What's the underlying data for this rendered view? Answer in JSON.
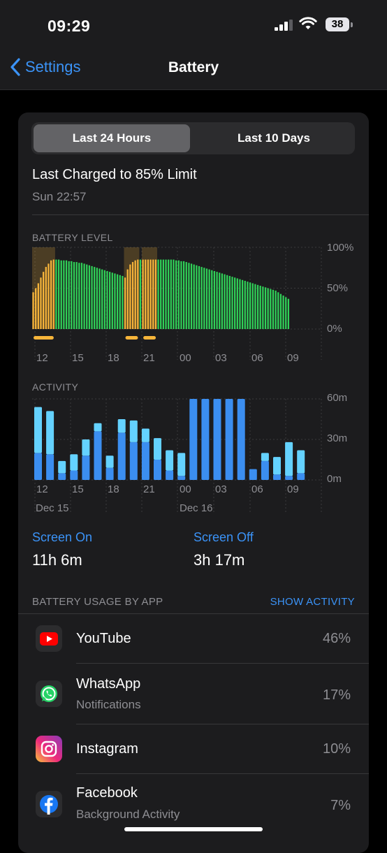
{
  "status_bar": {
    "time": "09:29",
    "battery_percent": "38"
  },
  "nav": {
    "back_label": "Settings",
    "title": "Battery"
  },
  "segmented": {
    "options": [
      "Last 24 Hours",
      "Last 10 Days"
    ],
    "selected": "Last 24 Hours"
  },
  "last_charged": {
    "title": "Last Charged to 85% Limit",
    "time": "Sun 22:57"
  },
  "battery_level": {
    "label": "BATTERY LEVEL",
    "y_ticks": [
      "100%",
      "50%",
      "0%"
    ],
    "x_ticks": [
      "12",
      "15",
      "18",
      "21",
      "00",
      "03",
      "06",
      "09"
    ]
  },
  "activity": {
    "label": "ACTIVITY",
    "y_ticks": [
      "60m",
      "30m",
      "0m"
    ],
    "x_ticks": [
      "12",
      "15",
      "18",
      "21",
      "00",
      "03",
      "06",
      "09"
    ],
    "dates": [
      "Dec 15",
      "Dec 16"
    ]
  },
  "screen": {
    "on_label": "Screen On",
    "on_value": "11h 6m",
    "off_label": "Screen Off",
    "off_value": "3h 17m"
  },
  "usage": {
    "header": "BATTERY USAGE BY APP",
    "show_activity": "SHOW ACTIVITY",
    "apps": [
      {
        "name": "YouTube",
        "subtitle": "",
        "percent": "46%",
        "icon": "youtube-icon"
      },
      {
        "name": "WhatsApp",
        "subtitle": "Notifications",
        "percent": "17%",
        "icon": "whatsapp-icon"
      },
      {
        "name": "Instagram",
        "subtitle": "",
        "percent": "10%",
        "icon": "instagram-icon"
      },
      {
        "name": "Facebook",
        "subtitle": "Background Activity",
        "percent": "7%",
        "icon": "facebook-icon"
      }
    ]
  },
  "colors": {
    "accent": "#3b93f7",
    "battery_green": "#30d158",
    "battery_charging": "#f7b53a",
    "activity_light": "#64d2ff",
    "activity_dark": "#3b8ef0",
    "card": "#1c1c1e"
  },
  "chart_data": [
    {
      "type": "bar",
      "title": "BATTERY LEVEL",
      "ylim": [
        0,
        100
      ],
      "y_unit": "%",
      "x_start_hour": 11.5,
      "hours_per_bar": 0.25,
      "levels": [
        45,
        50,
        56,
        63,
        70,
        76,
        80,
        84,
        85,
        85,
        85,
        84,
        84,
        84,
        83,
        83,
        82,
        82,
        81,
        81,
        80,
        79,
        78,
        77,
        76,
        75,
        74,
        73,
        72,
        71,
        70,
        69,
        68,
        67,
        66,
        65,
        63,
        73,
        79,
        82,
        84,
        85,
        85,
        85,
        85,
        85,
        85,
        85,
        85,
        85,
        85,
        85,
        85,
        85,
        85,
        85,
        84,
        84,
        83,
        83,
        82,
        81,
        80,
        79,
        78,
        77,
        76,
        75,
        74,
        73,
        72,
        71,
        70,
        69,
        68,
        67,
        66,
        65,
        64,
        63,
        62,
        61,
        60,
        59,
        58,
        57,
        56,
        55,
        54,
        53,
        52,
        51,
        50,
        49,
        48,
        47,
        45,
        43,
        41,
        39,
        37
      ],
      "charging_ranges": [
        [
          0,
          8
        ],
        [
          36,
          41
        ],
        [
          43,
          48
        ]
      ]
    },
    {
      "type": "bar",
      "title": "ACTIVITY",
      "ylim": [
        0,
        60
      ],
      "y_unit": "minutes",
      "x_start_hour": 11.5,
      "hours_per_bar": 1,
      "screen_on": [
        20,
        19,
        5,
        7,
        18,
        36,
        9,
        35,
        28,
        28,
        15,
        7,
        3,
        60,
        60,
        60,
        60,
        60,
        8,
        14,
        4,
        3,
        5
      ],
      "screen_off": [
        34,
        32,
        9,
        12,
        12,
        6,
        9,
        10,
        16,
        10,
        16,
        15,
        17,
        0,
        0,
        0,
        0,
        0,
        0,
        6,
        13,
        25,
        17
      ]
    }
  ]
}
